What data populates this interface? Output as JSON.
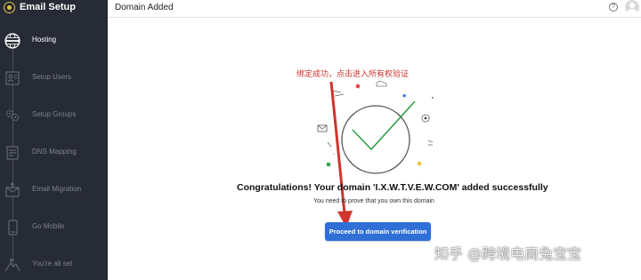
{
  "sidebar": {
    "app_title": "Email Setup",
    "logo_icon": "zoho-mail-logo",
    "steps": [
      {
        "label": "Hosting",
        "icon": "globe-server-icon",
        "active": true
      },
      {
        "label": "Setup Users",
        "icon": "user-card-icon",
        "active": false
      },
      {
        "label": "Setup Groups",
        "icon": "group-gears-icon",
        "active": false
      },
      {
        "label": "DNS Mapping",
        "icon": "dns-document-icon",
        "active": false
      },
      {
        "label": "Email Migration",
        "icon": "envelope-upload-icon",
        "active": false
      },
      {
        "label": "Go Mobile",
        "icon": "mobile-phone-icon",
        "active": false
      },
      {
        "label": "You're all set",
        "icon": "mountain-flag-icon",
        "active": false
      }
    ],
    "colors": {
      "background": "#272b35",
      "active_text": "#ffffff",
      "inactive_text": "#7d828d",
      "logo": "#e0c14a"
    }
  },
  "topbar": {
    "title": "Domain Added",
    "help_icon": "?",
    "avatar_icon": "user-avatar-icon"
  },
  "main": {
    "annotation": "绑定成功，点击进入所有权验证",
    "success_icon": "checkmark-circle-icon",
    "congrats_prefix": "Congratulations! Your domain '",
    "domain_masked": "I.X.W.T.V.E.W.COM",
    "congrats_suffix": "' added successfully",
    "subtext": "You need to prove that you own this domain",
    "proceed_button": "Proceed to domain verification",
    "colors": {
      "button": "#2f6fd6",
      "annotation": "#d0342c",
      "check": "#2e9e4b"
    }
  },
  "watermark": "知乎 @跨境电商兔宝宝"
}
